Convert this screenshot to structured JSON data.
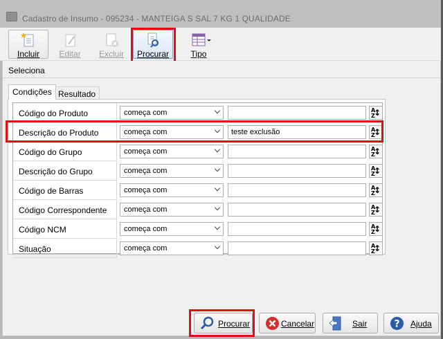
{
  "window": {
    "title": "Cadastro de Insumo - 095234 - MANTEIGA S  SAL 7 KG  1  QUALIDADE"
  },
  "toolbar": {
    "incluir": "Incluir",
    "editar": "Editar",
    "excluir": "Excluir",
    "procurar": "Procurar",
    "tipo": "Tipo"
  },
  "panel": {
    "heading": "Seleciona"
  },
  "tabs": [
    {
      "label": "Condições",
      "selected": true
    },
    {
      "label": "Resultado",
      "selected": false
    }
  ],
  "conditions": [
    {
      "field": "Código do Produto",
      "operator": "começa com",
      "value": ""
    },
    {
      "field": "Descrição do Produto",
      "operator": "começa com",
      "value": "teste exclusão"
    },
    {
      "field": "Código do Grupo",
      "operator": "começa com",
      "value": ""
    },
    {
      "field": "Descrição do Grupo",
      "operator": "começa com",
      "value": ""
    },
    {
      "field": "Código de Barras",
      "operator": "começa com",
      "value": ""
    },
    {
      "field": "Código Correspondente",
      "operator": "começa com",
      "value": ""
    },
    {
      "field": "Código NCM",
      "operator": "começa com",
      "value": ""
    },
    {
      "field": "Situação",
      "operator": "começa com",
      "value": ""
    }
  ],
  "footer": {
    "procurar": "Procurar",
    "cancelar": "Cancelar",
    "sair": "Sair",
    "ajuda": "Ajuda"
  },
  "colors": {
    "highlight": "#e01010",
    "accent": "#2a5caa",
    "cancel": "#d32f2f"
  }
}
